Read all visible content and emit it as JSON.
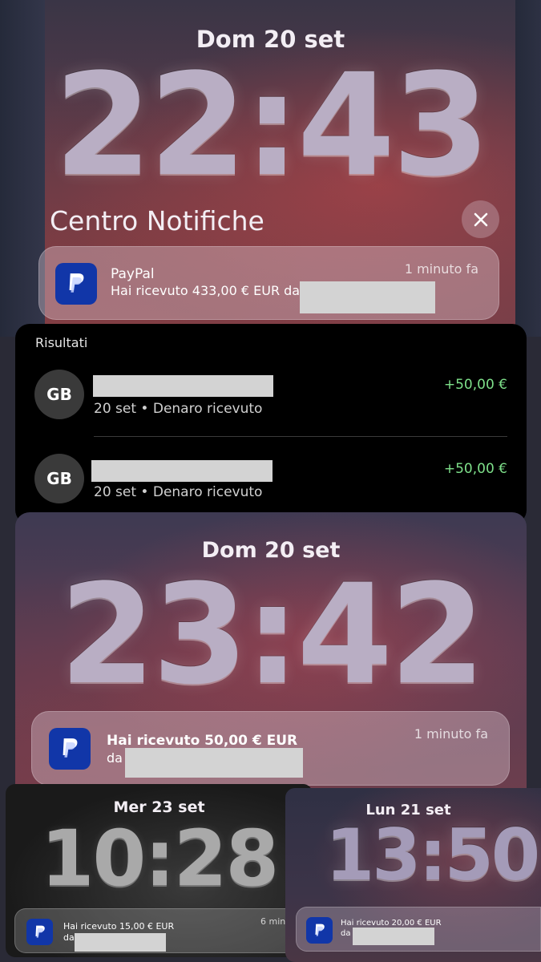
{
  "lock1": {
    "date": "Dom 20 set",
    "time": "22:43",
    "center_title": "Centro Notifiche",
    "notification": {
      "app": "PayPal",
      "text": "Hai ricevuto 433,00 € EUR da",
      "time": "1 minuto fa"
    }
  },
  "results": {
    "label": "Risultati",
    "rows": [
      {
        "initials": "GB",
        "subtitle": "20 set • Denaro ricevuto",
        "amount": "+50,00 €"
      },
      {
        "initials": "GB",
        "subtitle": "20 set • Denaro ricevuto",
        "amount": "+50,00 €"
      }
    ]
  },
  "lock2": {
    "date": "Dom 20 set",
    "time": "23:42",
    "notification": {
      "text": "Hai ricevuto 50,00 € EUR",
      "text_line2": "da",
      "time": "1 minuto fa"
    }
  },
  "lock3": {
    "date": "Mer 23 set",
    "time": "10:28",
    "notification": {
      "text": "Hai ricevuto 15,00 € EUR",
      "text_line2": "da",
      "time": "6 minu"
    }
  },
  "lock4": {
    "date": "Lun 21 set",
    "time": "13:50",
    "notification": {
      "text": "Hai ricevuto 20,00 € EUR",
      "text_line2": "da"
    }
  },
  "colors": {
    "paypal_blue": "#1136a8",
    "amount_green": "#7ee08a"
  },
  "icons": [
    "paypal-icon",
    "close-icon"
  ]
}
